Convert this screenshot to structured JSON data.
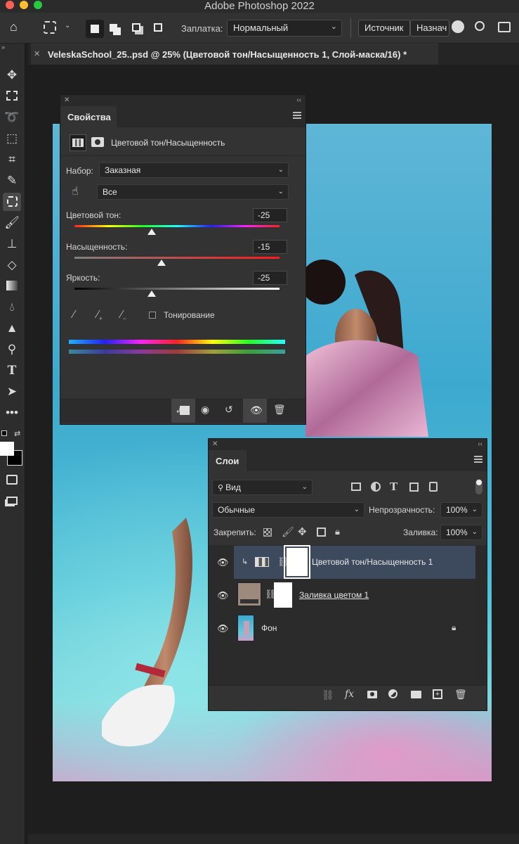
{
  "app_title": "Adobe Photoshop 2022",
  "options": {
    "patch_label": "Заплатка:",
    "patch_mode": "Нормальный",
    "source_button": "Источник",
    "dest_button": "Назнач"
  },
  "document": {
    "tab_title": "VeleskaSchool_25..psd @ 25% (Цветовой тон/Насыщенность 1, Слой-маска/16) *"
  },
  "properties": {
    "tab": "Свойства",
    "subtitle": "Цветовой тон/Насыщенность",
    "preset_label": "Набор:",
    "preset_value": "Заказная",
    "channel_value": "Все",
    "hue_label": "Цветовой тон:",
    "hue_value": "-25",
    "hue_position": 0.375,
    "saturation_label": "Насыщенность:",
    "saturation_value": "-15",
    "saturation_position": 0.425,
    "lightness_label": "Яркость:",
    "lightness_value": "-25",
    "lightness_position": 0.375,
    "colorize_label": "Тонирование",
    "colorize_checked": false
  },
  "layers": {
    "tab": "Слои",
    "filter_value": "Вид",
    "blend_mode": "Обычные",
    "opacity_label": "Непрозрачность:",
    "opacity_value": "100%",
    "lock_label": "Закрепить:",
    "fill_label": "Заливка:",
    "fill_value": "100%",
    "items": [
      {
        "name": "Цветовой тон/Насыщенность 1",
        "selected": true,
        "underline": false
      },
      {
        "name": "Заливка цветом 1",
        "selected": false,
        "underline": true,
        "fill_color": "#9c8a7e"
      },
      {
        "name": "Фон",
        "selected": false,
        "underline": false
      }
    ]
  },
  "colors": {
    "accent_selected_row": "#3d4a5e",
    "panel_bg": "#333333",
    "app_bg": "#1e1e1e"
  }
}
